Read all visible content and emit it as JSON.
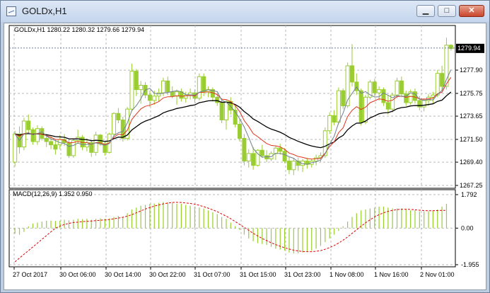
{
  "window": {
    "title": "GOLDx,H1",
    "minimize_label": "▁",
    "maximize_label": "□",
    "close_label": "✕"
  },
  "colors": {
    "bull": "#9acd32",
    "bear": "#9acd32",
    "ma_fast": "#708090",
    "ma_mid": "#e0341b",
    "ma_slow": "#000000",
    "histogram": "#9acd32",
    "signal": "#e00000",
    "grid": "#b8b8b8",
    "text": "#000000"
  },
  "main_chart": {
    "info": "GOLDx,H1  1280.22 1280.32 1279.66 1279.94",
    "current_price": "1279.94",
    "price_ticks": [
      "1277.90",
      "1275.75",
      "1273.65",
      "1271.50",
      "1269.40",
      "1267.25"
    ]
  },
  "macd_panel": {
    "info": "MACD(12,26,9) 1.352 0.950",
    "ticks": [
      "1.792",
      "0.00",
      "-1.955"
    ]
  },
  "time_axis": {
    "labels": [
      "27 Oct 2017",
      "30 Oct 06:00",
      "30 Oct 14:00",
      "30 Oct 22:00",
      "31 Oct 07:00",
      "31 Oct 15:00",
      "31 Oct 23:00",
      "1 Nov 08:00",
      "1 Nov 16:00",
      "2 Nov 01:00"
    ]
  },
  "chart_data": [
    {
      "type": "candlestick",
      "symbol": "GOLDx",
      "timeframe": "H1",
      "ylim": [
        1267.25,
        1281.5
      ],
      "last": {
        "open": 1280.22,
        "high": 1280.32,
        "low": 1279.66,
        "close": 1279.94
      },
      "candles": [
        [
          1269.4,
          1272.3,
          1269.0,
          1272.0
        ],
        [
          1272.0,
          1272.7,
          1270.2,
          1270.8
        ],
        [
          1270.8,
          1273.5,
          1270.5,
          1273.2
        ],
        [
          1273.2,
          1273.8,
          1272.0,
          1272.4
        ],
        [
          1272.4,
          1272.6,
          1271.0,
          1271.3
        ],
        [
          1271.3,
          1272.8,
          1271.0,
          1272.5
        ],
        [
          1272.5,
          1272.7,
          1271.4,
          1271.6
        ],
        [
          1271.6,
          1272.0,
          1270.8,
          1271.3
        ],
        [
          1271.3,
          1271.8,
          1270.6,
          1271.0
        ],
        [
          1271.0,
          1271.4,
          1270.1,
          1270.6
        ],
        [
          1271.0,
          1271.9,
          1270.6,
          1271.5
        ],
        [
          1271.5,
          1272.0,
          1270.9,
          1271.2
        ],
        [
          1271.2,
          1271.5,
          1269.8,
          1270.0
        ],
        [
          1270.0,
          1271.6,
          1269.8,
          1271.4
        ],
        [
          1271.4,
          1272.4,
          1271.1,
          1271.7
        ],
        [
          1271.7,
          1271.9,
          1270.5,
          1270.8
        ],
        [
          1270.8,
          1271.6,
          1270.4,
          1271.2
        ],
        [
          1271.2,
          1271.4,
          1269.9,
          1270.3
        ],
        [
          1270.3,
          1272.2,
          1270.0,
          1271.9
        ],
        [
          1271.9,
          1272.0,
          1270.9,
          1271.1
        ],
        [
          1271.1,
          1271.3,
          1270.0,
          1270.3
        ],
        [
          1270.3,
          1272.1,
          1270.2,
          1272.0
        ],
        [
          1272.0,
          1274.0,
          1271.8,
          1273.9
        ],
        [
          1273.9,
          1274.4,
          1273.0,
          1273.3
        ],
        [
          1273.3,
          1273.6,
          1271.3,
          1271.6
        ],
        [
          1271.6,
          1274.5,
          1271.4,
          1274.3
        ],
        [
          1274.3,
          1278.5,
          1274.1,
          1277.8
        ],
        [
          1277.8,
          1278.0,
          1275.5,
          1276.1
        ],
        [
          1276.1,
          1276.9,
          1274.8,
          1276.5
        ],
        [
          1276.5,
          1276.8,
          1275.3,
          1275.6
        ],
        [
          1275.6,
          1276.0,
          1274.5,
          1275.1
        ],
        [
          1275.1,
          1276.0,
          1274.7,
          1275.5
        ],
        [
          1275.5,
          1276.2,
          1275.0,
          1275.8
        ],
        [
          1275.8,
          1277.2,
          1275.5,
          1276.9
        ],
        [
          1276.9,
          1277.3,
          1275.6,
          1275.9
        ],
        [
          1275.9,
          1276.4,
          1275.3,
          1275.5
        ],
        [
          1275.5,
          1276.1,
          1274.7,
          1275.9
        ],
        [
          1275.9,
          1276.2,
          1275.0,
          1275.3
        ],
        [
          1275.3,
          1275.9,
          1274.9,
          1275.6
        ],
        [
          1275.6,
          1276.2,
          1275.2,
          1275.8
        ],
        [
          1275.8,
          1276.1,
          1274.9,
          1275.3
        ],
        [
          1275.3,
          1277.6,
          1275.1,
          1277.3
        ],
        [
          1277.3,
          1277.6,
          1275.5,
          1275.9
        ],
        [
          1275.9,
          1276.4,
          1275.4,
          1276.1
        ],
        [
          1276.1,
          1276.3,
          1275.0,
          1275.4
        ],
        [
          1275.4,
          1275.8,
          1274.6,
          1274.9
        ],
        [
          1274.9,
          1275.3,
          1273.0,
          1273.3
        ],
        [
          1273.3,
          1275.2,
          1272.4,
          1275.0
        ],
        [
          1275.0,
          1275.4,
          1273.8,
          1274.2
        ],
        [
          1274.2,
          1274.6,
          1272.6,
          1272.9
        ],
        [
          1272.9,
          1273.4,
          1271.3,
          1271.6
        ],
        [
          1271.6,
          1272.0,
          1269.1,
          1269.5
        ],
        [
          1269.5,
          1270.6,
          1268.9,
          1270.2
        ],
        [
          1270.2,
          1270.8,
          1268.7,
          1269.1
        ],
        [
          1269.1,
          1270.6,
          1269.0,
          1270.5
        ],
        [
          1270.5,
          1271.0,
          1269.8,
          1270.0
        ],
        [
          1270.0,
          1270.5,
          1269.4,
          1269.7
        ],
        [
          1269.7,
          1270.4,
          1269.5,
          1270.2
        ],
        [
          1270.2,
          1270.9,
          1269.6,
          1270.7
        ],
        [
          1270.7,
          1271.1,
          1270.1,
          1270.4
        ],
        [
          1270.4,
          1270.7,
          1269.3,
          1269.5
        ],
        [
          1269.5,
          1269.9,
          1268.3,
          1268.7
        ],
        [
          1268.7,
          1269.8,
          1268.2,
          1269.5
        ],
        [
          1269.5,
          1269.8,
          1268.6,
          1269.1
        ],
        [
          1269.1,
          1269.7,
          1268.5,
          1269.5
        ],
        [
          1269.5,
          1269.8,
          1268.8,
          1269.2
        ],
        [
          1269.2,
          1269.7,
          1268.9,
          1269.5
        ],
        [
          1269.5,
          1270.1,
          1269.1,
          1269.8
        ],
        [
          1269.8,
          1270.3,
          1269.4,
          1270.0
        ],
        [
          1270.0,
          1272.6,
          1269.8,
          1272.3
        ],
        [
          1272.3,
          1274.0,
          1272.0,
          1273.7
        ],
        [
          1273.7,
          1274.2,
          1272.8,
          1273.1
        ],
        [
          1273.1,
          1276.3,
          1272.9,
          1276.0
        ],
        [
          1276.0,
          1276.2,
          1274.3,
          1274.6
        ],
        [
          1274.6,
          1278.6,
          1274.4,
          1278.3
        ],
        [
          1278.3,
          1280.3,
          1276.4,
          1276.8
        ],
        [
          1276.8,
          1277.6,
          1275.6,
          1276.0
        ],
        [
          1276.0,
          1276.2,
          1272.8,
          1273.1
        ],
        [
          1273.1,
          1275.6,
          1272.9,
          1275.4
        ],
        [
          1275.4,
          1277.0,
          1275.2,
          1276.8
        ],
        [
          1276.8,
          1277.1,
          1275.5,
          1275.8
        ],
        [
          1275.8,
          1276.4,
          1275.1,
          1276.1
        ],
        [
          1276.1,
          1276.3,
          1274.6,
          1274.9
        ],
        [
          1274.9,
          1275.6,
          1273.8,
          1274.3
        ],
        [
          1274.3,
          1275.8,
          1274.0,
          1275.6
        ],
        [
          1275.6,
          1277.2,
          1275.3,
          1276.9
        ],
        [
          1276.9,
          1277.3,
          1275.4,
          1275.7
        ],
        [
          1275.7,
          1276.0,
          1274.6,
          1274.9
        ],
        [
          1274.9,
          1276.1,
          1274.7,
          1275.9
        ],
        [
          1275.9,
          1276.2,
          1274.8,
          1275.1
        ],
        [
          1275.1,
          1275.5,
          1274.2,
          1274.5
        ],
        [
          1274.5,
          1275.3,
          1274.1,
          1275.1
        ],
        [
          1275.1,
          1275.7,
          1274.6,
          1275.4
        ],
        [
          1275.4,
          1275.9,
          1274.8,
          1275.6
        ],
        [
          1275.6,
          1277.9,
          1275.4,
          1277.6
        ],
        [
          1277.6,
          1278.3,
          1276.0,
          1276.4
        ],
        [
          1276.4,
          1280.9,
          1276.1,
          1280.2
        ],
        [
          1280.2,
          1280.3,
          1279.7,
          1279.9
        ]
      ]
    },
    {
      "type": "bar",
      "name": "MACD(12,26,9)",
      "ylim": [
        -1.955,
        1.792
      ],
      "histogram": [
        -0.3,
        -0.35,
        -0.2,
        0.1,
        0.25,
        0.3,
        0.35,
        0.4,
        0.4,
        0.38,
        0.4,
        0.45,
        0.42,
        0.45,
        0.5,
        0.48,
        0.5,
        0.45,
        0.5,
        0.52,
        0.5,
        0.52,
        0.6,
        0.65,
        0.6,
        0.8,
        1.0,
        1.1,
        1.2,
        1.25,
        1.3,
        1.32,
        1.35,
        1.4,
        1.38,
        1.35,
        1.3,
        1.3,
        1.25,
        1.2,
        1.15,
        1.1,
        1.05,
        0.95,
        0.85,
        0.75,
        0.6,
        0.5,
        0.3,
        0.1,
        -0.1,
        -0.35,
        -0.55,
        -0.7,
        -0.8,
        -0.85,
        -0.9,
        -1.0,
        -1.1,
        -1.15,
        -1.2,
        -1.3,
        -1.35,
        -1.35,
        -1.3,
        -1.25,
        -1.2,
        -1.1,
        -0.95,
        -0.75,
        -0.55,
        -0.35,
        -0.15,
        0.1,
        0.35,
        0.6,
        0.8,
        0.95,
        1.0,
        1.05,
        1.1,
        1.15,
        1.15,
        1.1,
        1.05,
        1.05,
        1.05,
        1.0,
        0.95,
        0.95,
        0.9,
        0.9,
        0.9,
        0.95,
        1.0,
        1.15,
        1.3
      ],
      "signal": [
        -1.8,
        -1.6,
        -1.4,
        -1.2,
        -1.0,
        -0.8,
        -0.6,
        -0.4,
        -0.2,
        0.0,
        0.1,
        0.2,
        0.25,
        0.3,
        0.32,
        0.35,
        0.36,
        0.38,
        0.4,
        0.42,
        0.44,
        0.46,
        0.5,
        0.54,
        0.58,
        0.64,
        0.72,
        0.82,
        0.92,
        1.02,
        1.1,
        1.18,
        1.24,
        1.3,
        1.34,
        1.37,
        1.38,
        1.37,
        1.35,
        1.32,
        1.28,
        1.22,
        1.15,
        1.07,
        0.98,
        0.88,
        0.76,
        0.64,
        0.5,
        0.35,
        0.2,
        0.04,
        -0.12,
        -0.28,
        -0.42,
        -0.55,
        -0.67,
        -0.78,
        -0.88,
        -0.97,
        -1.05,
        -1.12,
        -1.18,
        -1.22,
        -1.25,
        -1.26,
        -1.26,
        -1.24,
        -1.2,
        -1.13,
        -1.04,
        -0.93,
        -0.8,
        -0.64,
        -0.47,
        -0.28,
        -0.09,
        0.1,
        0.28,
        0.45,
        0.6,
        0.72,
        0.82,
        0.9,
        0.95,
        0.99,
        1.01,
        1.01,
        1.0,
        0.98,
        0.96,
        0.94,
        0.93,
        0.93,
        0.94,
        0.95,
        0.95
      ]
    }
  ]
}
